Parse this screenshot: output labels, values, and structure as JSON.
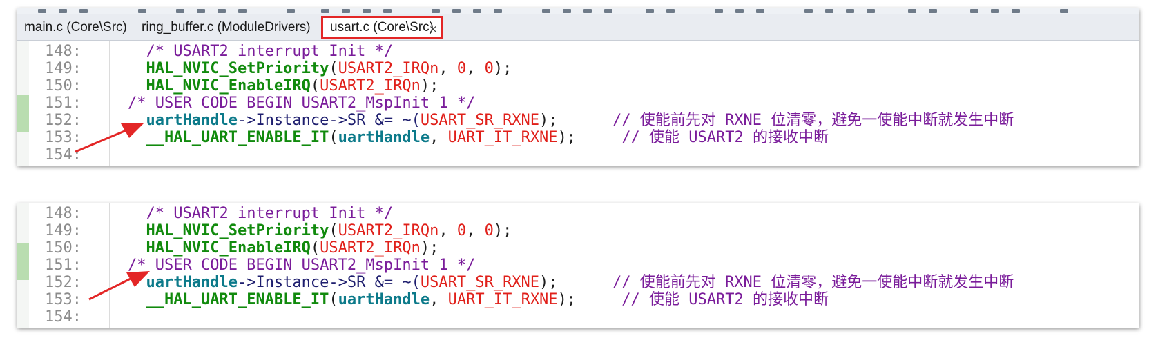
{
  "tabs": [
    {
      "label": "main.c (Core\\Src)",
      "active": false
    },
    {
      "label": "ring_buffer.c (ModuleDrivers)",
      "active": false
    },
    {
      "label": "usart.c (Core\\Src)",
      "active": true
    }
  ],
  "tab_close_glyph": "×",
  "lines": [
    {
      "no": "148:",
      "indent": "  ",
      "parts": [
        {
          "t": "/* USART2 interrupt Init */",
          "c": "cm"
        }
      ]
    },
    {
      "no": "149:",
      "indent": "  ",
      "parts": [
        {
          "t": "HAL_NVIC_SetPriority",
          "c": "fn"
        },
        {
          "t": "(",
          "c": "op"
        },
        {
          "t": "USART2_IRQn",
          "c": "mc"
        },
        {
          "t": ", ",
          "c": "op"
        },
        {
          "t": "0",
          "c": "nu"
        },
        {
          "t": ", ",
          "c": "op"
        },
        {
          "t": "0",
          "c": "nu"
        },
        {
          "t": ");",
          "c": "op"
        }
      ]
    },
    {
      "no": "150:",
      "indent": "  ",
      "parts": [
        {
          "t": "HAL_NVIC_EnableIRQ",
          "c": "fn"
        },
        {
          "t": "(",
          "c": "op"
        },
        {
          "t": "USART2_IRQn",
          "c": "mc"
        },
        {
          "t": ");",
          "c": "op"
        }
      ]
    },
    {
      "no": "151:",
      "indent": "",
      "parts": [
        {
          "t": "/* USER CODE BEGIN USART2_MspInit 1 */",
          "c": "cm"
        }
      ]
    },
    {
      "no": "152:",
      "indent": "  ",
      "parts": [
        {
          "t": "uartHandle",
          "c": "vr"
        },
        {
          "t": "->Instance->SR &= ~(",
          "c": "tx"
        },
        {
          "t": "USART_SR_RXNE",
          "c": "mc"
        },
        {
          "t": ");      ",
          "c": "op"
        },
        {
          "t": "// 使能前先对 RXNE 位清零，避免一使能中断就发生中断",
          "c": "cm"
        }
      ]
    },
    {
      "no": "153:",
      "indent": "  ",
      "parts": [
        {
          "t": "__HAL_UART_ENABLE_IT",
          "c": "fn"
        },
        {
          "t": "(",
          "c": "op"
        },
        {
          "t": "uartHandle",
          "c": "vr"
        },
        {
          "t": ", ",
          "c": "op"
        },
        {
          "t": "UART_IT_RXNE",
          "c": "mc"
        },
        {
          "t": ");     ",
          "c": "op"
        },
        {
          "t": "// 使能 USART2 的接收中断",
          "c": "cm"
        }
      ]
    },
    {
      "no": "154:",
      "indent": "",
      "parts": []
    }
  ]
}
